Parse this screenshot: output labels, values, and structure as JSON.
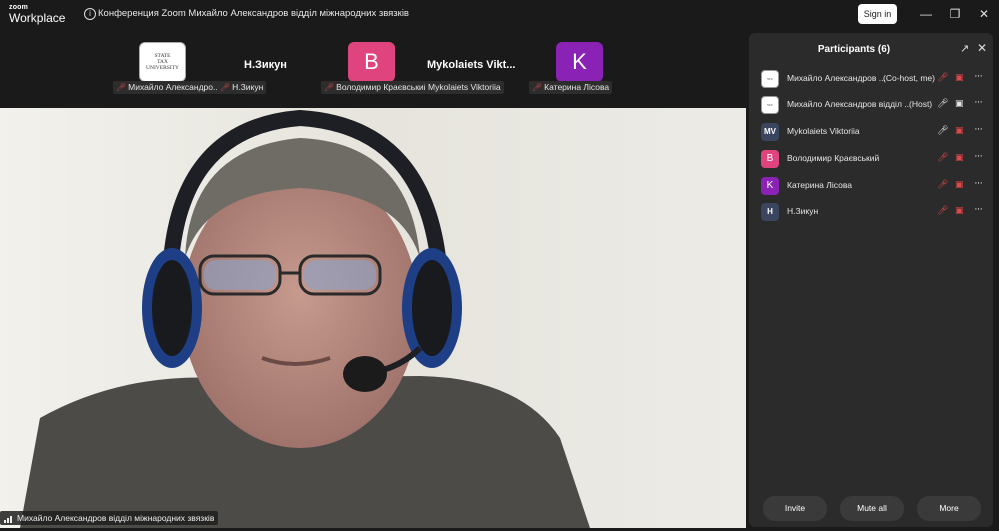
{
  "app": {
    "logo_line1": "zoom",
    "logo_line2": "Workplace",
    "meeting_title": "Конференция Zoom Михайло Александров відділ міжнародних звязків",
    "sign_in": "Sign in"
  },
  "strip": {
    "tiles": [
      {
        "name_tag": "Михайло Александро...",
        "logo_text": [
          "STATE",
          "TAX",
          "UNIVERSITY"
        ]
      },
      {
        "title": "Н.Зикун",
        "name_tag": "Н.Зикун"
      },
      {
        "letter": "B",
        "name_tag": "Володимир Краєвський",
        "color": "#e0447f"
      },
      {
        "title": "Mykolaiets  Vikt...",
        "name_tag": "Mykolaiets Viktoriia"
      },
      {
        "letter": "K",
        "name_tag": "Катерина Лісова",
        "color": "#8a22b5"
      }
    ]
  },
  "video": {
    "speaker_name": "Михайло Александров відділ міжнародних звязків"
  },
  "panel": {
    "title": "Participants (6)",
    "participants": [
      {
        "name": "Михайло Александров ...",
        "role": "(Co-host, me)",
        "avatar": "logo",
        "mic": "muted",
        "cam": "off"
      },
      {
        "name": "Михайло Александров відділ ...",
        "role": "(Host)",
        "avatar": "logo",
        "mic": "on",
        "cam": "on"
      },
      {
        "name": "Mykolaiets Viktoriia",
        "role": "",
        "avatar": "MV",
        "avatar_color": "#3a4660",
        "mic": "on",
        "cam": "off"
      },
      {
        "name": "Володимир Краєвський",
        "role": "",
        "avatar": "B",
        "avatar_color": "#e0447f",
        "mic": "muted",
        "cam": "off"
      },
      {
        "name": "Катерина Лісова",
        "role": "",
        "avatar": "K",
        "avatar_color": "#8a22b5",
        "mic": "muted",
        "cam": "off"
      },
      {
        "name": "Н.Зикун",
        "role": "",
        "avatar": "Н",
        "avatar_color": "#3a4660",
        "mic": "muted",
        "cam": "off"
      }
    ],
    "buttons": {
      "invite": "Invite",
      "mute_all": "Mute all",
      "more": "More"
    }
  }
}
